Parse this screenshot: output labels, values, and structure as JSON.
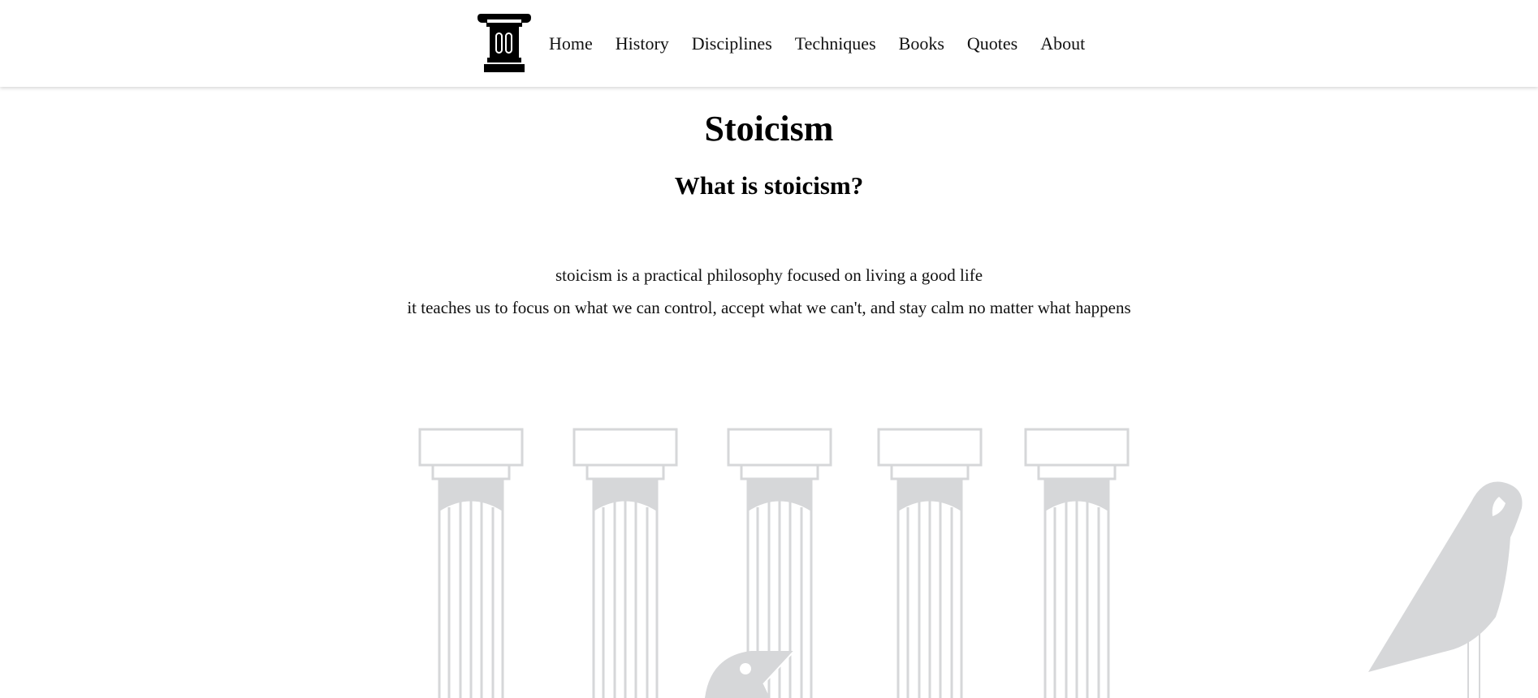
{
  "nav": {
    "logo_icon": "ionic-column-icon",
    "items": [
      {
        "label": "Home"
      },
      {
        "label": "History"
      },
      {
        "label": "Disciplines"
      },
      {
        "label": "Techniques"
      },
      {
        "label": "Books"
      },
      {
        "label": "Quotes"
      },
      {
        "label": "About"
      }
    ]
  },
  "hero": {
    "title": "Stoicism",
    "subtitle": "What is stoicism?",
    "intro_line_1": "stoicism is a practical philosophy focused on living a good life",
    "intro_line_2": "it teaches us to focus on what we can control, accept what we can't, and stay calm no matter what happens"
  },
  "illustration": {
    "icons": [
      "column-icon",
      "bird-icon"
    ],
    "color": "#d6d7d9"
  }
}
